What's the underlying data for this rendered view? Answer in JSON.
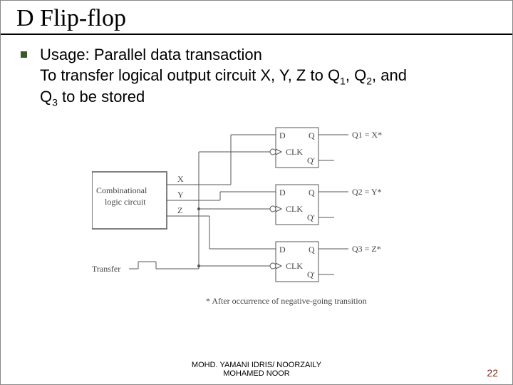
{
  "title": "D Flip-flop",
  "body": {
    "line1": "Usage: Parallel data transaction",
    "line2_a": "To transfer logical output circuit X, Y, Z to Q",
    "line2_sub1": "1",
    "line2_b": ", Q",
    "line2_sub2": "2",
    "line2_c": ", and",
    "line3_a": "Q",
    "line3_sub": "3",
    "line3_b": " to be stored"
  },
  "diagram": {
    "box_line1": "Combinational",
    "box_line2": "logic circuit",
    "sig_x": "X",
    "sig_y": "Y",
    "sig_z": "Z",
    "transfer": "Transfer",
    "ff_d": "D",
    "ff_q": "Q",
    "ff_clk": "CLK",
    "ff_qbar": "Q'",
    "out1": "Q1 = X*",
    "out2": "Q2 = Y*",
    "out3": "Q3 = Z*",
    "note": "* After occurrence of negative-going transition"
  },
  "footer": {
    "line1": "MOHD. YAMANI IDRIS/ NOORZAILY",
    "line2": "MOHAMED NOOR"
  },
  "page": "22"
}
